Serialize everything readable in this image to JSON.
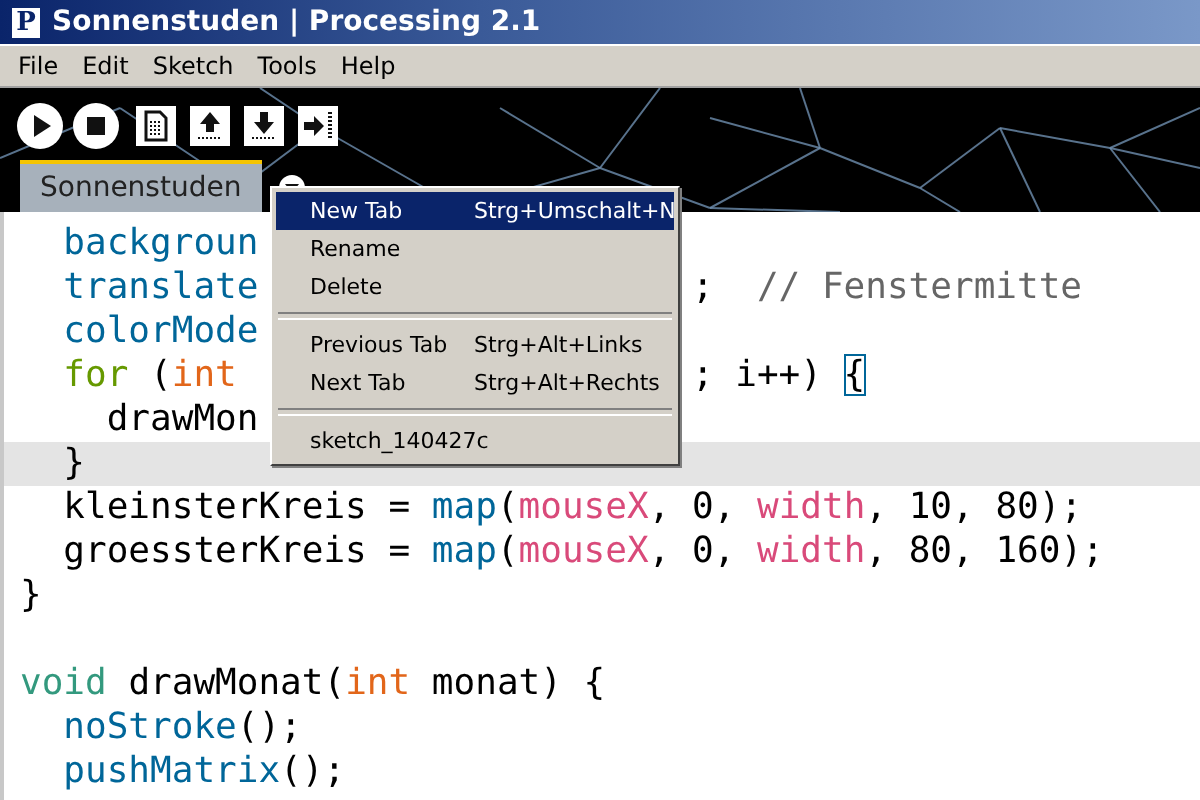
{
  "window": {
    "title": "Sonnenstuden | Processing 2.1",
    "app_icon": "P"
  },
  "menu_bar": [
    "File",
    "Edit",
    "Sketch",
    "Tools",
    "Help"
  ],
  "toolbar": {
    "buttons": [
      {
        "kind": "run"
      },
      {
        "kind": "stop"
      },
      {
        "kind": "new"
      },
      {
        "kind": "open"
      },
      {
        "kind": "save"
      },
      {
        "kind": "export"
      }
    ]
  },
  "tabs": [
    {
      "label": "Sonnenstuden",
      "selected": true
    }
  ],
  "tab_menu": [
    {
      "kind": "item",
      "label": "New Tab",
      "shortcut": "Strg+Umschalt+N",
      "selected": true
    },
    {
      "kind": "item",
      "label": "Rename",
      "selected": false
    },
    {
      "kind": "item",
      "label": "Delete",
      "selected": false
    },
    {
      "kind": "separator"
    },
    {
      "kind": "item",
      "label": "Previous Tab",
      "shortcut": "Strg+Alt+Links",
      "selected": false
    },
    {
      "kind": "item",
      "label": "Next Tab",
      "shortcut": "Strg+Alt+Rechts",
      "selected": false
    },
    {
      "kind": "separator"
    },
    {
      "kind": "item",
      "label": "sketch_140427c",
      "selected": false
    }
  ],
  "code_lines": [
    {
      "current": false,
      "left": [
        {
          "kind": "fn",
          "text": "  backgroun"
        }
      ]
    },
    {
      "current": false,
      "left": [
        {
          "kind": "fn",
          "text": "  translate"
        }
      ],
      "right": [
        {
          "kind": "plain",
          "text": ";  "
        },
        {
          "kind": "comment",
          "text": "// Fenstermitte"
        }
      ]
    },
    {
      "current": false,
      "left": [
        {
          "kind": "fn",
          "text": "  colorMode"
        }
      ]
    },
    {
      "current": false,
      "left": [
        {
          "kind": "kw",
          "text": "  for"
        },
        {
          "kind": "plain",
          "text": " ("
        },
        {
          "kind": "type",
          "text": "int"
        }
      ],
      "right": [
        {
          "kind": "plain",
          "text": "; i++) "
        },
        {
          "kind": "bracket",
          "text": "{"
        }
      ]
    },
    {
      "current": false,
      "left": [
        {
          "kind": "plain",
          "text": "    drawMon"
        }
      ]
    },
    {
      "current": true,
      "left": [
        {
          "kind": "plain",
          "text": "  }"
        }
      ]
    },
    {
      "current": false,
      "left": [
        {
          "kind": "plain",
          "text": "  kleinsterKreis = "
        },
        {
          "kind": "fn",
          "text": "map"
        },
        {
          "kind": "plain",
          "text": "("
        },
        {
          "kind": "var",
          "text": "mouseX"
        },
        {
          "kind": "plain",
          "text": ", 0, "
        },
        {
          "kind": "var",
          "text": "width"
        },
        {
          "kind": "plain",
          "text": ", 10, 80);"
        }
      ]
    },
    {
      "current": false,
      "left": [
        {
          "kind": "plain",
          "text": "  groessterKreis = "
        },
        {
          "kind": "fn",
          "text": "map"
        },
        {
          "kind": "plain",
          "text": "("
        },
        {
          "kind": "var",
          "text": "mouseX"
        },
        {
          "kind": "plain",
          "text": ", 0, "
        },
        {
          "kind": "var",
          "text": "width"
        },
        {
          "kind": "plain",
          "text": ", 80, 160);"
        }
      ]
    },
    {
      "current": false,
      "left": [
        {
          "kind": "plain",
          "text": "}"
        }
      ]
    },
    {
      "current": false
    },
    {
      "current": false,
      "left": [
        {
          "kind": "void",
          "text": "void"
        },
        {
          "kind": "plain",
          "text": " drawMonat("
        },
        {
          "kind": "type",
          "text": "int"
        },
        {
          "kind": "plain",
          "text": " monat) {"
        }
      ]
    },
    {
      "current": false,
      "left": [
        {
          "kind": "fn",
          "text": "  noStroke"
        },
        {
          "kind": "plain",
          "text": "();"
        }
      ]
    },
    {
      "current": false,
      "left": [
        {
          "kind": "fn",
          "text": "  pushMatrix"
        },
        {
          "kind": "plain",
          "text": "();"
        }
      ]
    }
  ]
}
